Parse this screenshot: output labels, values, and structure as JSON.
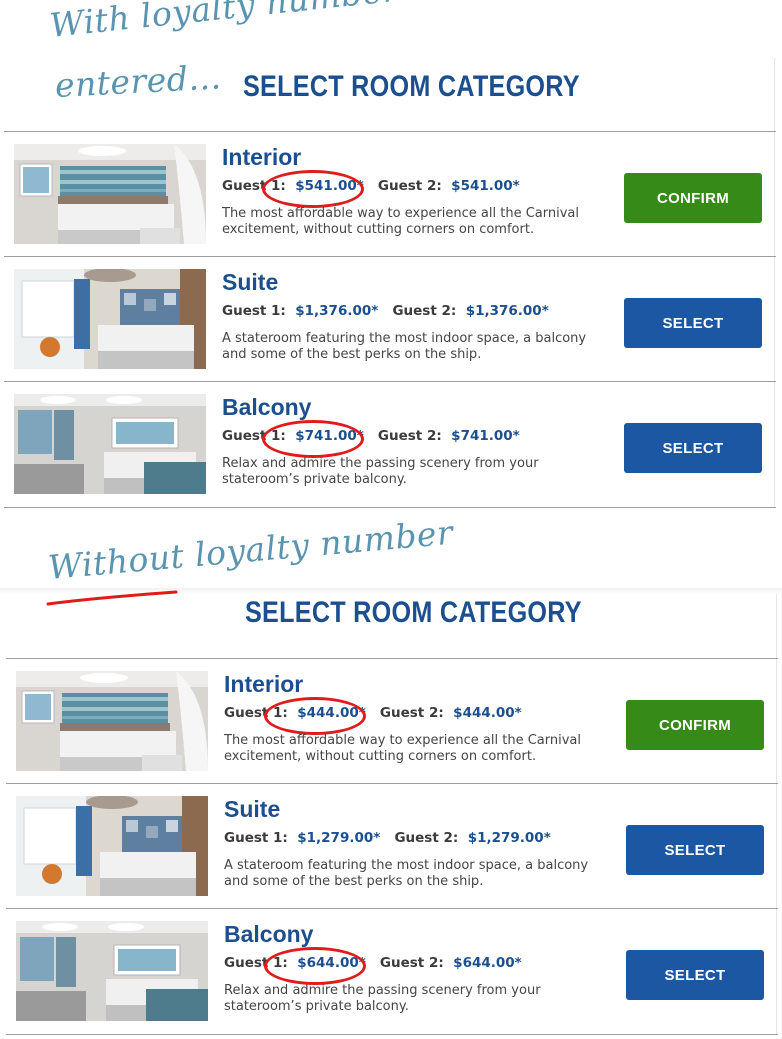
{
  "colors": {
    "primary_blue": "#1c4f8f",
    "button_blue": "#1b57a3",
    "confirm_green": "#368a17",
    "annotation": "#5a94b0",
    "highlight_red": "#e01b1b"
  },
  "sections": [
    {
      "annotation_line1": "With loyalty number",
      "annotation_line2": "entered...",
      "title": "SELECT ROOM CATEGORY",
      "rooms": [
        {
          "name": "Interior",
          "guest1_label": "Guest 1:",
          "guest1_price": "$541.00*",
          "guest2_label": "Guest 2:",
          "guest2_price": "$541.00*",
          "description": "The most affordable way to experience all the Carnival excitement, without cutting corners on comfort.",
          "button": "CONFIRM"
        },
        {
          "name": "Suite",
          "guest1_label": "Guest 1:",
          "guest1_price": "$1,376.00*",
          "guest2_label": "Guest 2:",
          "guest2_price": "$1,376.00*",
          "description": "A stateroom featuring the most indoor space, a balcony and some of the best perks on the ship.",
          "button": "SELECT"
        },
        {
          "name": "Balcony",
          "guest1_label": "Guest 1:",
          "guest1_price": "$741.00*",
          "guest2_label": "Guest 2:",
          "guest2_price": "$741.00*",
          "description": "Relax and admire the passing scenery from your stateroom’s private balcony.",
          "button": "SELECT"
        }
      ]
    },
    {
      "annotation_line1": "Without loyalty number",
      "title": "SELECT ROOM CATEGORY",
      "rooms": [
        {
          "name": "Interior",
          "guest1_label": "Guest 1:",
          "guest1_price": "$444.00*",
          "guest2_label": "Guest 2:",
          "guest2_price": "$444.00*",
          "description": "The most affordable way to experience all the Carnival excitement, without cutting corners on comfort.",
          "button": "CONFIRM"
        },
        {
          "name": "Suite",
          "guest1_label": "Guest 1:",
          "guest1_price": "$1,279.00*",
          "guest2_label": "Guest 2:",
          "guest2_price": "$1,279.00*",
          "description": "A stateroom featuring the most indoor space, a balcony and some of the best perks on the ship.",
          "button": "SELECT"
        },
        {
          "name": "Balcony",
          "guest1_label": "Guest 1:",
          "guest1_price": "$644.00*",
          "guest2_label": "Guest 2:",
          "guest2_price": "$644.00*",
          "description": "Relax and admire the passing scenery from your stateroom’s private balcony.",
          "button": "SELECT"
        }
      ]
    }
  ]
}
